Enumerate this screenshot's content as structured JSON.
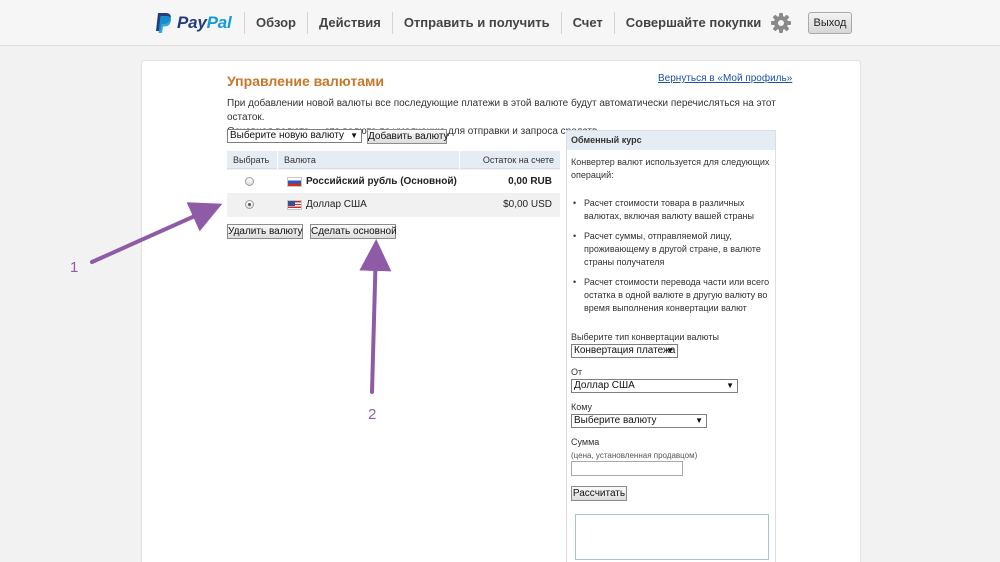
{
  "header": {
    "logo_part1": "Pay",
    "logo_part2": "Pal",
    "nav": [
      "Обзор",
      "Действия",
      "Отправить и получить",
      "Счет",
      "Совершайте покупки"
    ],
    "settings_icon": "gear-icon",
    "logout_label": "Выход"
  },
  "main": {
    "title": "Управление валютами",
    "back_link": "Вернуться в «Мой профиль»",
    "description_line1": "При добавлении новой валюты все последующие платежи в этой валюте будут автоматически перечисляться на этот остаток.",
    "description_line2": "Основная валюта — это валюта по умолчанию для отправки и запроса средств.",
    "new_currency_select": "Выберите новую валюту",
    "add_currency_button": "Добавить валюту",
    "table": {
      "headers": [
        "Выбрать",
        "Валюта",
        "Остаток на счете"
      ],
      "rows": [
        {
          "currency": "Российский рубль (Основной)",
          "balance": "0,00 RUB",
          "flag": "flag-ru",
          "selected": false
        },
        {
          "currency": "Доллар США",
          "balance": "$0,00 USD",
          "flag": "flag-us",
          "selected": true
        }
      ]
    },
    "delete_button": "Удалить валюту",
    "make_primary_button": "Сделать основной"
  },
  "sidebar": {
    "title": "Обменный курс",
    "intro": "Конвертер валют используется для следующих операций:",
    "bullets": [
      "Расчет стоимости товара в различных валютах, включая валюту вашей страны",
      "Расчет суммы, отправляемой лицу, проживающему в другой стране, в валюте страны получателя",
      "Расчет стоимости перевода части или всего остатка в одной валюте в другую валюту во время выполнения конвертации валют"
    ],
    "conversion_type_label": "Выберите тип конвертации валюты",
    "conversion_type_value": "Конвертация платежа",
    "from_label": "От",
    "from_value": "Доллар США",
    "to_label": "Кому",
    "to_value": "Выберите валюту",
    "amount_label": "Сумма",
    "amount_hint": "(цена, установленная продавцом)",
    "calculate_button": "Рассчитать"
  },
  "annotations": {
    "label_1": "1",
    "label_2": "2",
    "color": "#8f5ba7"
  }
}
